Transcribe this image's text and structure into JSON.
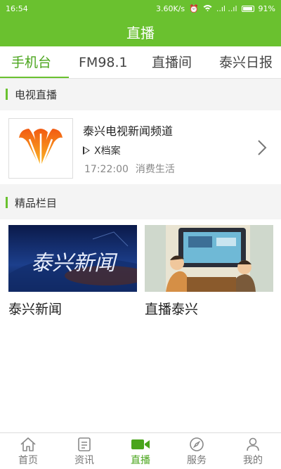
{
  "status_bar": {
    "time": "16:54",
    "speed": "3.60K/s",
    "signal": "..ıl ..ıl",
    "battery": "91%"
  },
  "header": {
    "title": "直播"
  },
  "tabs": [
    {
      "label": "手机台",
      "active": true
    },
    {
      "label": "FM98.1",
      "active": false
    },
    {
      "label": "直播间",
      "active": false
    },
    {
      "label": "泰兴日报",
      "active": false
    }
  ],
  "sections": {
    "tv": "电视直播",
    "featured": "精品栏目"
  },
  "channel": {
    "name": "泰兴电视新闻频道",
    "program": "X档案",
    "time": "17:22:00",
    "next": "消费生活"
  },
  "featured": [
    {
      "label": "泰兴新闻",
      "thumb_text": "泰兴新闻"
    },
    {
      "label": "直播泰兴"
    }
  ],
  "nav": [
    {
      "label": "首页",
      "icon": "home-icon",
      "active": false
    },
    {
      "label": "资讯",
      "icon": "news-icon",
      "active": false
    },
    {
      "label": "直播",
      "icon": "video-camera-icon",
      "active": true
    },
    {
      "label": "服务",
      "icon": "compass-icon",
      "active": false
    },
    {
      "label": "我的",
      "icon": "user-icon",
      "active": false
    }
  ],
  "colors": {
    "accent": "#6ac12f",
    "accent_text": "#4aa51c"
  }
}
